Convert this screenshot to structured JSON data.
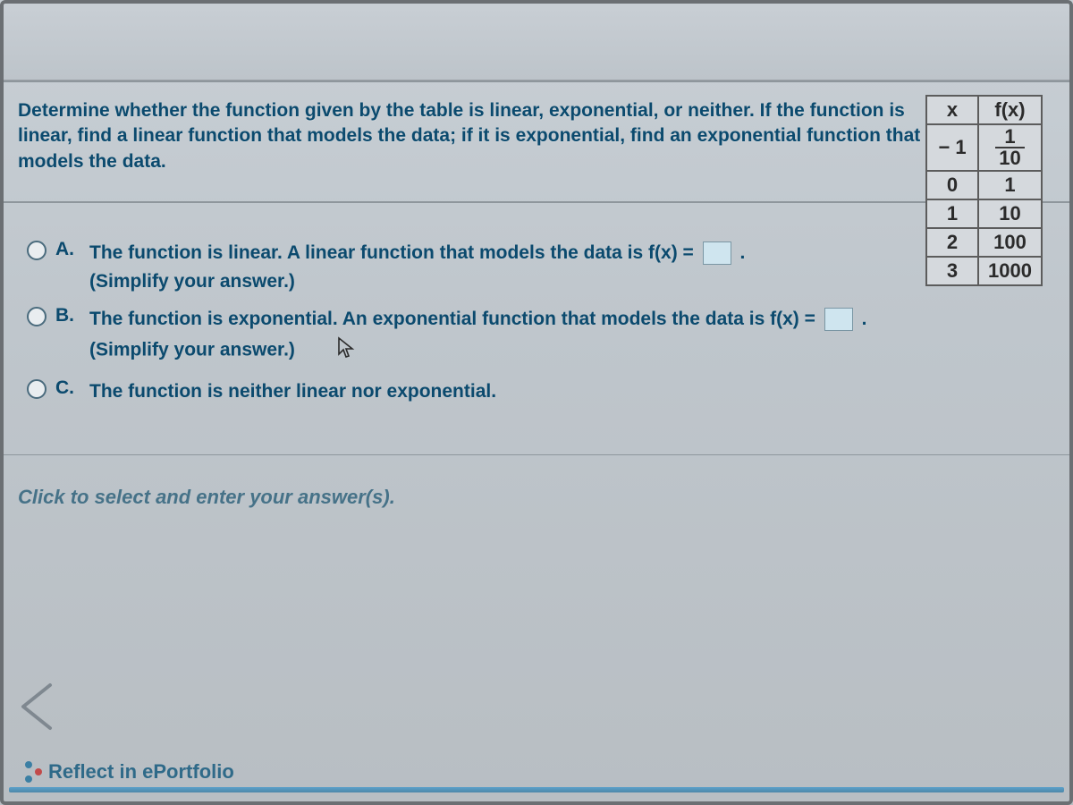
{
  "question": {
    "prompt": "Determine whether the function given by the table is linear, exponential, or neither. If the function is linear, find a linear function that models the data; if it is exponential, find an exponential function that models the data.",
    "table": {
      "headers": {
        "x": "x",
        "fx": "f(x)"
      },
      "rows": [
        {
          "x": "− 1",
          "fx_num": "1",
          "fx_den": "10",
          "is_fraction": true
        },
        {
          "x": "0",
          "fx": "1"
        },
        {
          "x": "1",
          "fx": "10"
        },
        {
          "x": "2",
          "fx": "100"
        },
        {
          "x": "3",
          "fx": "1000"
        }
      ]
    }
  },
  "choices": {
    "A": {
      "letter": "A.",
      "text": "The function is linear. A linear function that models the data is f(x) =",
      "period": ".",
      "simplify": "(Simplify your answer.)"
    },
    "B": {
      "letter": "B.",
      "text": "The function is exponential. An exponential function that models the data is f(x) =",
      "period": ".",
      "simplify": "(Simplify your answer.)"
    },
    "C": {
      "letter": "C.",
      "text": "The function is neither linear nor exponential."
    }
  },
  "instruction": "Click to select and enter your answer(s).",
  "footer": {
    "link": "Reflect in ePortfolio"
  }
}
